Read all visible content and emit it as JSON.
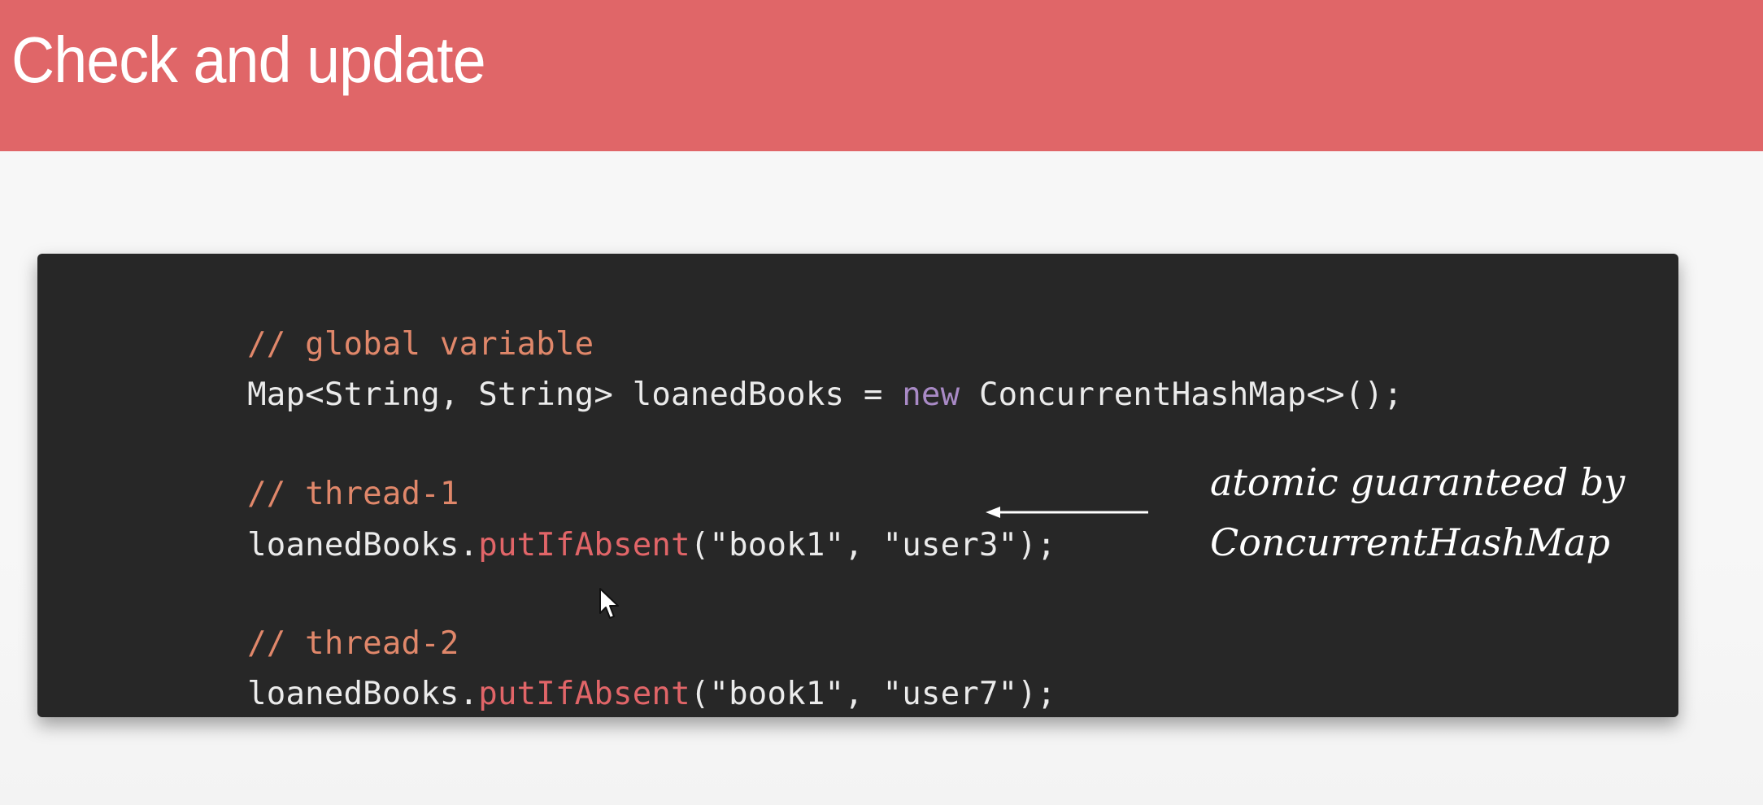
{
  "slide": {
    "title": "Check and update"
  },
  "code": {
    "line1": "// global variable",
    "line2": {
      "type": "Map<String, String>",
      "name": " loanedBooks = ",
      "kw": "new",
      "rest": " ConcurrentHashMap<>();"
    },
    "line3": "// thread-1",
    "line4": {
      "object": "loanedBooks.",
      "method": "putIfAbsent",
      "args": "(\"book1\", \"user3\");"
    },
    "line5": "// thread-2",
    "line6": {
      "object": "loanedBooks.",
      "method": "putIfAbsent",
      "args": "(\"book1\", \"user7\");"
    }
  },
  "annotation": {
    "line1": "atomic guaranteed by",
    "line2": "ConcurrentHashMap"
  },
  "colors": {
    "title_bar": "#e06668",
    "code_bg": "#272727",
    "comment": "#e0876a",
    "keyword": "#a98ac6",
    "method": "#e16568"
  },
  "icons": {
    "arrow": "left-arrow-icon",
    "cursor": "mouse-cursor-icon"
  }
}
